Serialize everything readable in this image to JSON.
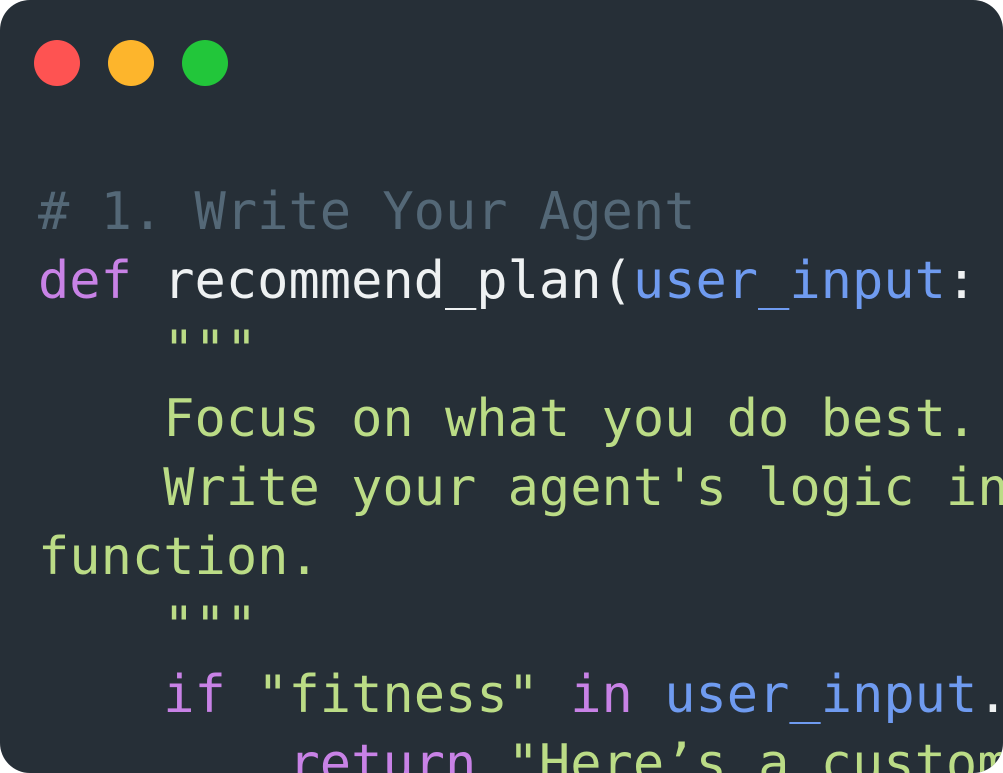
{
  "window": {
    "controls": {
      "close_color": "#fe5352",
      "minimize_color": "#fdb52c",
      "maximize_color": "#22c63a"
    }
  },
  "code": {
    "line1": {
      "comment": "# 1. Write Your Agent"
    },
    "line2": {
      "keyword": "def",
      "fn": " recommend_plan(",
      "param": "user_input",
      "punct": ":"
    },
    "line3": {
      "indent": "    ",
      "string": "\"\"\""
    },
    "line4": {
      "indent": "    ",
      "string": "Focus on what you do best."
    },
    "line5": {
      "indent": "    ",
      "string": "Write your agent's logic in"
    },
    "line6": {
      "string": "function."
    },
    "line7": {
      "indent": "    ",
      "string": "\"\"\""
    },
    "line8": {
      "indent": "    ",
      "kw_if": "if",
      "space1": " ",
      "string": "\"fitness\"",
      "space2": " ",
      "kw_in": "in",
      "space3": " ",
      "param": "user_input",
      "punct": "."
    },
    "line9": {
      "indent": "        ",
      "kw_return": "return",
      "space": " ",
      "string": "\"Here’s a custom"
    }
  }
}
